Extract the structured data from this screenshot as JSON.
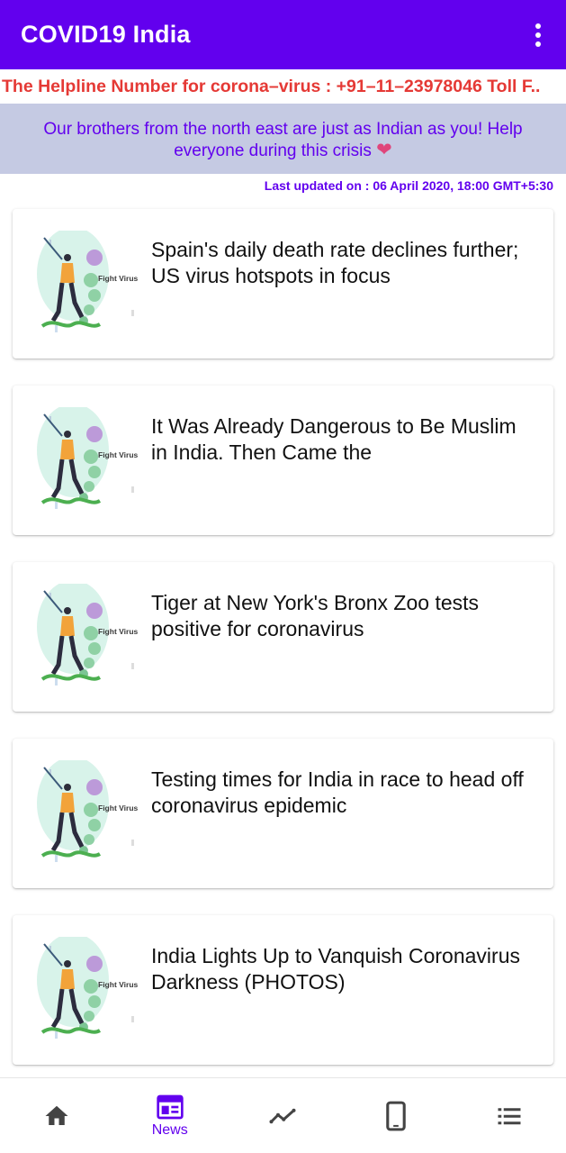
{
  "app_bar": {
    "title": "COVID19 India",
    "overflow_icon": "more-vert-icon"
  },
  "helpline": {
    "text": "The Helpline Number for corona–virus : +91–11–23978046 Toll F.."
  },
  "banner": {
    "text": "Our brothers from the north east are just as Indian as you! Help everyone during this crisis",
    "icon": "heart-icon"
  },
  "last_updated": {
    "text": "Last updated on : 06 April 2020, 18:00 GMT+5:30"
  },
  "news": [
    {
      "title": "Spain's daily death rate declines further; US virus hotspots in focus",
      "thumb_label": "Fight Virus"
    },
    {
      "title": "It Was Already Dangerous to Be Muslim in India. Then Came the",
      "thumb_label": "Fight Virus"
    },
    {
      "title": "Tiger at New York's Bronx Zoo tests positive for coronavirus",
      "thumb_label": "Fight Virus"
    },
    {
      "title": "Testing times for India in race to head off coronavirus epidemic",
      "thumb_label": "Fight Virus"
    },
    {
      "title": "India Lights Up to Vanquish Coronavirus Darkness (PHOTOS)",
      "thumb_label": "Fight Virus"
    }
  ],
  "bottom_nav": {
    "items": [
      {
        "icon": "home-icon",
        "label": ""
      },
      {
        "icon": "news-icon",
        "label": "News",
        "selected": true
      },
      {
        "icon": "trend-icon",
        "label": ""
      },
      {
        "icon": "phone-icon",
        "label": ""
      },
      {
        "icon": "list-icon",
        "label": ""
      }
    ]
  },
  "colors": {
    "primary": "#6200ee",
    "helpline": "#e53935",
    "banner_bg": "#c5cae3",
    "heart": "#e0457b",
    "nav_icon": "#444444"
  }
}
